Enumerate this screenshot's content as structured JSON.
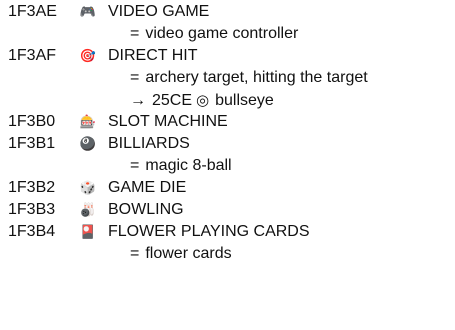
{
  "entries": [
    {
      "code": "1F3AE",
      "glyph": "🎮",
      "glyph_icon": "video-game-controller-icon",
      "name": "VIDEO GAME",
      "notes": [
        {
          "prefix": "=",
          "text": "video game controller"
        }
      ]
    },
    {
      "code": "1F3AF",
      "glyph": "🎯",
      "glyph_icon": "direct-hit-target-icon",
      "name": "DIRECT HIT",
      "notes": [
        {
          "prefix": "=",
          "text": "archery target, hitting the target"
        },
        {
          "prefix": "→",
          "xref_code": "25CE",
          "xref_glyph": "◎",
          "text": "bullseye"
        }
      ]
    },
    {
      "code": "1F3B0",
      "glyph": "🎰",
      "glyph_icon": "slot-machine-icon",
      "name": "SLOT MACHINE",
      "notes": []
    },
    {
      "code": "1F3B1",
      "glyph": "🎱",
      "glyph_icon": "billiards-icon",
      "name": "BILLIARDS",
      "notes": [
        {
          "prefix": "=",
          "text": "magic 8-ball"
        }
      ]
    },
    {
      "code": "1F3B2",
      "glyph": "🎲",
      "glyph_icon": "game-die-icon",
      "name": "GAME DIE",
      "notes": []
    },
    {
      "code": "1F3B3",
      "glyph": "🎳",
      "glyph_icon": "bowling-icon",
      "name": "BOWLING",
      "notes": []
    },
    {
      "code": "1F3B4",
      "glyph": "🎴",
      "glyph_icon": "flower-playing-cards-icon",
      "name": "FLOWER PLAYING CARDS",
      "notes": [
        {
          "prefix": "=",
          "text": "flower cards"
        }
      ]
    }
  ]
}
